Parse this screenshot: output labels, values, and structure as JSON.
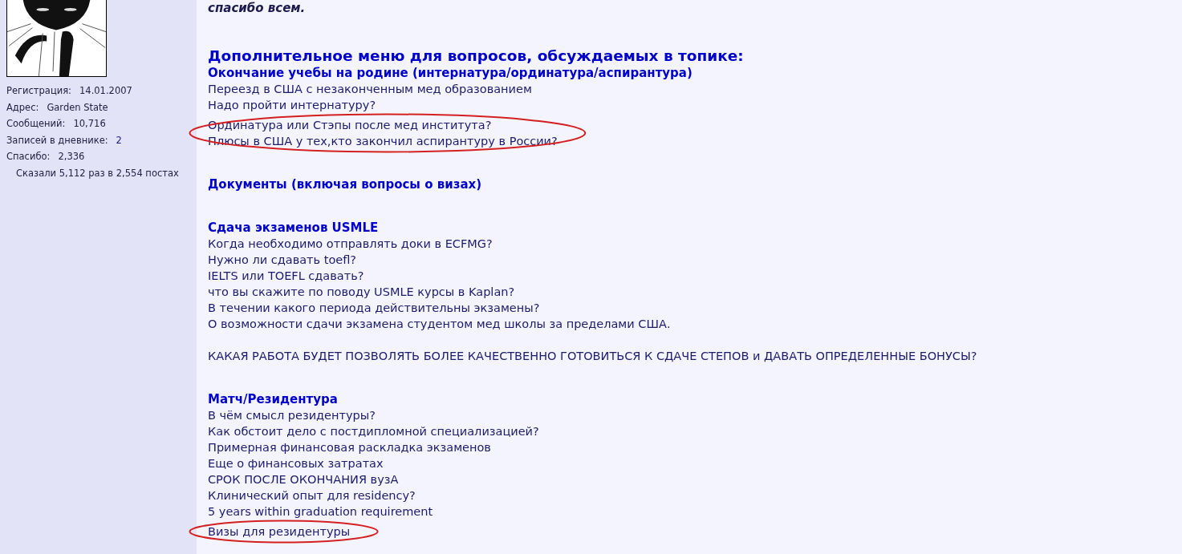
{
  "post_intro": {
    "text": "спасибо всем."
  },
  "profile": {
    "stats": [
      {
        "label": "Регистрация:",
        "value": "14.01.2007",
        "link": false
      },
      {
        "label": "Адрес:",
        "value": "Garden State",
        "link": false
      },
      {
        "label": "Сообщений:",
        "value": "10,716",
        "link": false
      },
      {
        "label": "Записей в дневнике:",
        "value": "2",
        "link": true
      },
      {
        "label": "Спасибо:",
        "value": "2,336",
        "link": false
      }
    ],
    "thanks_note": "Сказали 5,112 раз в 2,554 постах"
  },
  "menu": {
    "title": "Дополнительное меню для вопросов, обсуждаемых в топике:",
    "sections": [
      {
        "heading": "Окончание учебы на родине (интернатура/ординатура/аспирантура)",
        "groups": [
          [
            {
              "text": "Переезд в США с незаконченным мед образованием",
              "circled": false
            },
            {
              "text": "Надо пройти интернатуру?",
              "circled": false
            },
            {
              "text": "Ординатура или Стэпы после мед института?",
              "circled": true
            },
            {
              "text": "Плюсы в США у тех,кто закончил аспирантуру в России?",
              "circled": true
            }
          ]
        ]
      },
      {
        "heading": "Документы (включая вопросы о визах)"
      },
      {
        "heading": "Сдача экзаменов USMLE",
        "groups": [
          [
            {
              "text": "Когда необходимо отправлять доки в ECFMG?",
              "circled": false
            },
            {
              "text": "Нужно ли сдавать toefl?",
              "circled": false
            },
            {
              "text": "IELTS или TOEFL сдавать?",
              "circled": false
            },
            {
              "text": "что вы скажите по поводу USMLE курсы в Kaplan?",
              "circled": false
            },
            {
              "text": "В течении какого периода действительны экзамены?",
              "circled": false
            },
            {
              "text": "О возможности сдачи экзамена студентом мед школы за пределами США.",
              "circled": false
            }
          ],
          [
            {
              "text": "КАКАЯ РАБОТА БУДЕТ ПОЗВОЛЯТЬ БОЛЕЕ КАЧЕСТВЕННО ГОТОВИТЬСЯ К СДАЧЕ СТЕПОВ и ДАВАТЬ ОПРЕДЕЛЕННЫЕ БОНУСЫ?",
              "circled": false
            }
          ]
        ]
      },
      {
        "heading": "Матч/Резидентура",
        "groups": [
          [
            {
              "text": "В чём смысл резидентуры?",
              "circled": false
            },
            {
              "text": "Как обстоит дело с постдипломной специализацией?",
              "circled": false
            },
            {
              "text": "Примерная финансовая раскладка экзаменов",
              "circled": false
            },
            {
              "text": "Еще о финансовых затратах",
              "circled": false
            },
            {
              "text": "СРОК ПОСЛЕ ОКОНЧАНИЯ вузА",
              "circled": false
            },
            {
              "text": "Клинический опыт для residency?",
              "circled": false
            },
            {
              "text": "5 years within graduation requirement",
              "circled": false
            },
            {
              "text": "Визы для резидентуры",
              "circled": true
            }
          ]
        ]
      }
    ]
  }
}
